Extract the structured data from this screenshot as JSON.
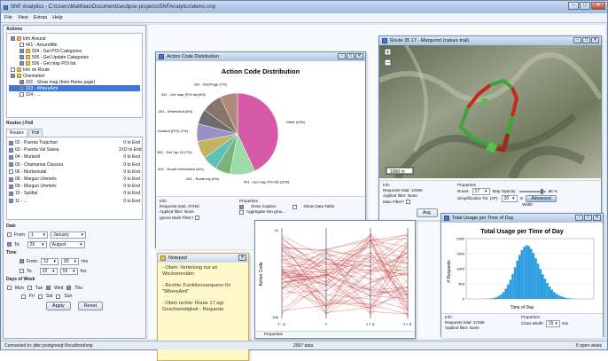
{
  "window": {
    "title": "SNF Analytics - C:\\Users\\Matthias\\Documents\\eclipse-projects\\SNFAnalytics\\demo.snp",
    "minimize": "–",
    "maximize": "□",
    "close": "✕"
  },
  "menu": [
    "File",
    "View",
    "Extras",
    "Help"
  ],
  "left": {
    "actions_label": "Actions",
    "tree": [
      {
        "label": "Info Around",
        "depth": 0,
        "checked": true,
        "folder": true
      },
      {
        "label": "461 - AroundMe",
        "depth": 1,
        "checked": false,
        "folder": false
      },
      {
        "label": "504 - Get POI Categories",
        "depth": 1,
        "checked": true,
        "folder": true
      },
      {
        "label": "505 - Get Update Categories",
        "depth": 1,
        "checked": true,
        "folder": true
      },
      {
        "label": "506 - Get map POI list",
        "depth": 1,
        "checked": true,
        "folder": true
      },
      {
        "label": "Info on Route",
        "depth": 0,
        "checked": false,
        "folder": true
      },
      {
        "label": "Orientation",
        "depth": 0,
        "checked": true,
        "folder": true
      },
      {
        "label": "201 - Show map (from Home page)",
        "depth": 1,
        "checked": true,
        "folder": false
      },
      {
        "label": "223 - WhereAmI",
        "depth": 1,
        "checked": true,
        "folder": false,
        "selected": true
      },
      {
        "label": "224 - ...",
        "depth": 1,
        "checked": false,
        "folder": false
      }
    ],
    "routes_label": "Routes | Poll",
    "tabs": [
      "Routes",
      "Poll"
    ],
    "routes": [
      {
        "name": "02 - Puenta Trupchun",
        "value": "0 to End",
        "checked": true
      },
      {
        "name": "03 - Puenta Val Sassa",
        "value": "3:02 to End",
        "checked": true
      },
      {
        "name": "04 - Murtaröl",
        "value": "0 to End",
        "checked": true
      },
      {
        "name": "05 - Chamanna Cluozza",
        "value": "0 to End",
        "checked": true
      },
      {
        "name": "06 - Murtaroutal",
        "value": "0 to End",
        "checked": false
      },
      {
        "name": "08 - Margun Ummels",
        "value": "0 to End",
        "checked": true
      },
      {
        "name": "09 - Margun Ummels",
        "value": "0 to End",
        "checked": true
      },
      {
        "name": "10 - Spöltal",
        "value": "0 to End",
        "checked": true
      },
      {
        "name": "11 - ...",
        "value": "0 to End",
        "checked": true
      }
    ],
    "date_label": "Date",
    "from_label": "From:",
    "from_day": "1",
    "from_month": "January",
    "to_label": "To:",
    "to_day": "26",
    "to_month": "August",
    "time_label": "Time",
    "time_from_label": "From:",
    "time_from_h": "12",
    "time_from_m": "00",
    "hrs": "hrs",
    "time_to_label": "To:",
    "time_to_h": "22",
    "time_to_m": "59",
    "dow_label": "Days of Week",
    "days": [
      "Mon",
      "Tue",
      "Wed",
      "Thu"
    ],
    "days2": [
      "Fri",
      "Sat",
      "Sun"
    ],
    "apply": "Apply",
    "reset": "Reset"
  },
  "status": {
    "left": "Connected to: jdbc:postgresql://localhost/snp",
    "mid": "2007 data",
    "right": "5 open views"
  },
  "pie": {
    "win_title": "Action Code Distribution",
    "chart_data": {
      "type": "pie",
      "title": "Action Code Distribution",
      "slices": [
        {
          "label": "Other (43%)",
          "value": 43,
          "color": "#d65aa6"
        },
        {
          "label": "501 - Get map POI list (10%)",
          "value": 10,
          "color": "#9ed9a8"
        },
        {
          "label": "501 - Route trip (6%)",
          "value": 6,
          "color": "#7ab37a"
        },
        {
          "label": "501 - Route information (6%)",
          "value": 6,
          "color": "#5fc0b5"
        },
        {
          "label": "501 - Get Top 15 (7%)",
          "value": 7,
          "color": "#c2b35f"
        },
        {
          "label": "505 - Content (POI) (7%)",
          "value": 7,
          "color": "#9a8fc9"
        },
        {
          "label": "201 - WhereAmI (6%)",
          "value": 6,
          "color": "#6d6d70"
        },
        {
          "label": "201 - Get map (POI list (8%)",
          "value": 8,
          "color": "#88746a"
        },
        {
          "label": "200 - InterPage (7%)",
          "value": 7,
          "color": "#b0897a"
        }
      ]
    },
    "info_label": "Info",
    "requests": "Requests total: 47466",
    "filter": "Applied filter: None",
    "ignore": "Ignore Main Filter?",
    "props_label": "Properties",
    "show_caption": "Show Caption",
    "show_table": "Show Data Table",
    "aggregate": "Aggregate into grou..."
  },
  "map": {
    "win_title": "Route 35 17 - Margunet (nature trail)",
    "scale": "1000 m",
    "info_label": "Info",
    "requests": "Requests total: 10465",
    "filter": "Applied filter: None",
    "ignore": "Main Filter?",
    "props_label": "Properties",
    "route_label": "Route:",
    "route_val": "17",
    "opacity_label": "Map Opacity:",
    "opacity_val": "88 %",
    "simp_label": "Simplification Tol. (2P):",
    "simp_val": "20",
    "simp_unit": "m",
    "advanced": "Advanced",
    "width_label": "Width"
  },
  "notepad": {
    "win_title": "Notepad",
    "lines": [
      "- Oben: Verteilung nur an Wochenenden",
      "- Rechts: Funktionssequenz für \"WhereAmI\"",
      "- Oben rechts: Route 17 ugl. Geschwindigkeit - Requests"
    ]
  },
  "parallel": {
    "ylabel": "Action Code",
    "xticks": [
      "t - 1",
      "t",
      "t + 1",
      "t + 2"
    ],
    "ytick_top": "10",
    "ytick_bottom": "100",
    "props_label": "Properties",
    "avg": "Avg."
  },
  "hist": {
    "win_title": "Total Usage per Time of Day",
    "chart_data": {
      "type": "bar",
      "title": "Total Usage per Time of Day",
      "xlabel": "Time of Day",
      "ylabel": "# Requests",
      "ylim": [
        0,
        2000
      ],
      "yticks": [
        "2000",
        "1500",
        "1000",
        "500",
        "0"
      ],
      "values": [
        5,
        8,
        12,
        20,
        35,
        60,
        95,
        150,
        230,
        340,
        480,
        640,
        830,
        1050,
        1270,
        1460,
        1620,
        1730,
        1780,
        1750,
        1660,
        1520,
        1350,
        1170,
        990,
        820,
        670,
        530,
        410,
        310,
        230,
        170,
        120,
        85,
        60,
        40,
        26,
        16,
        10,
        6
      ]
    },
    "info_label": "Info",
    "requests": "Requests total: 47466",
    "filter": "Applied filter: None",
    "props_label": "Properties",
    "class_width": "Class Width:",
    "cw_val": "15",
    "cw_unit": "min"
  }
}
